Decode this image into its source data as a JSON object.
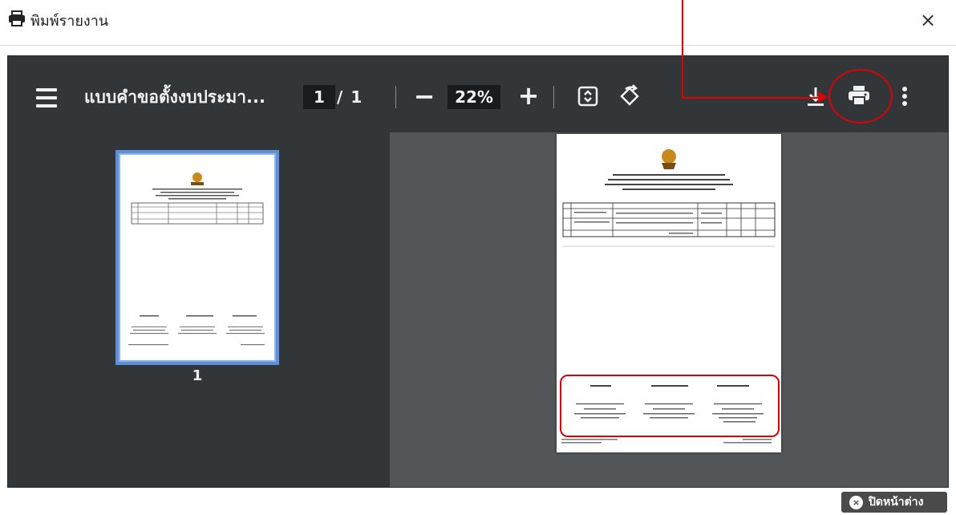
{
  "modal": {
    "title": "พิมพ์รายงาน",
    "close_symbol": "×"
  },
  "viewer": {
    "document_title": "แบบคำขอตั้งงบประมา...",
    "current_page": "1",
    "page_separator": "/",
    "total_pages": "1",
    "zoom_out_symbol": "−",
    "zoom_level": "22%",
    "zoom_in_symbol": "+",
    "thumbnail_label": "1",
    "icons": [
      "menu-icon",
      "fit-page-icon",
      "rotate-icon",
      "download-icon",
      "print-icon",
      "more-options-icon"
    ]
  },
  "footer": {
    "close_window_label": "ปิดหน้าต่าง",
    "close_window_symbol": "×"
  },
  "colors": {
    "annotation": "#e00000",
    "toolbar": "#323639",
    "viewer_bg": "#525659",
    "thumb_highlight": "#8ab4f8"
  }
}
